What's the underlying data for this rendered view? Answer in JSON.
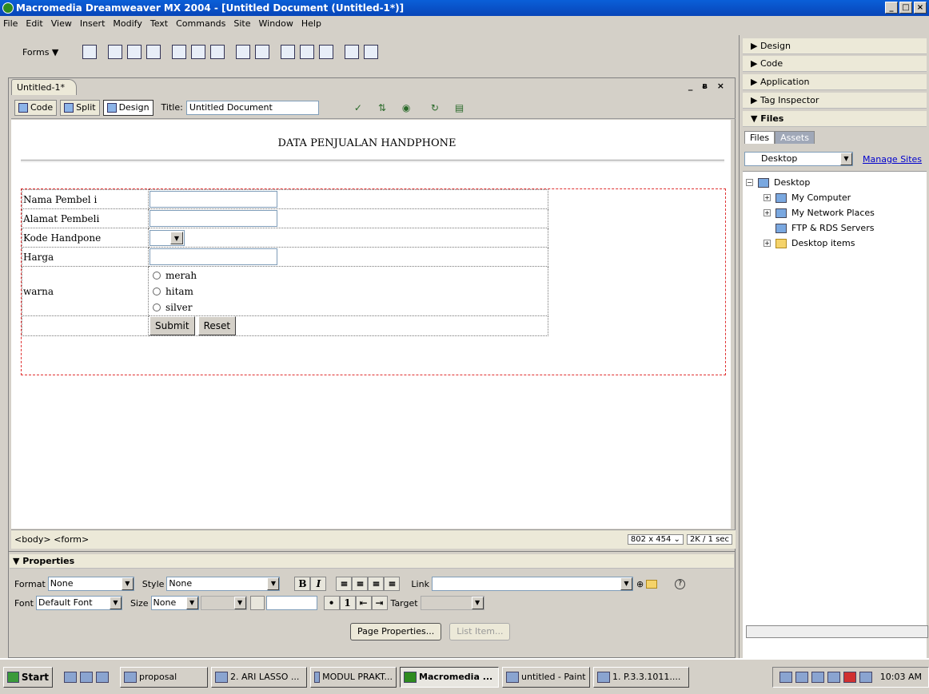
{
  "window": {
    "title": "Macromedia Dreamweaver MX 2004 - [Untitled Document (Untitled-1*)]",
    "controls": [
      "_",
      "□",
      "×"
    ]
  },
  "menubar": [
    "File",
    "Edit",
    "View",
    "Insert",
    "Modify",
    "Text",
    "Commands",
    "Site",
    "Window",
    "Help"
  ],
  "insert_bar": {
    "category": "Forms ▼"
  },
  "document": {
    "tab": "Untitled-1*",
    "window_controls": "_ ᴃ ×",
    "view_buttons": {
      "code": "Code",
      "split": "Split",
      "design": "Design"
    },
    "title_label": "Title:",
    "title_value": "Untitled Document"
  },
  "page": {
    "heading": "DATA PENJUALAN HANDPHONE",
    "form": {
      "rows": [
        {
          "label": "Nama Pembel i"
        },
        {
          "label": "Alamat Pembeli"
        },
        {
          "label": "Kode Handpone"
        },
        {
          "label": "Harga"
        },
        {
          "label": "warna"
        }
      ],
      "radios": [
        "merah",
        "hitam",
        "silver"
      ],
      "submit": "Submit",
      "reset": "Reset"
    }
  },
  "statusbar": {
    "tags": "<body> <form>",
    "size": "802 x 454 ⌄",
    "download": "2K / 1 sec"
  },
  "properties": {
    "header": "▼ Properties",
    "format_label": "Format",
    "format_value": "None",
    "style_label": "Style",
    "style_value": "None",
    "font_label": "Font",
    "font_value": "Default Font",
    "size_label": "Size",
    "size_value": "None",
    "link_label": "Link",
    "target_label": "Target",
    "bold": "B",
    "italic": "I",
    "page_properties": "Page Properties...",
    "list_item": "List Item..."
  },
  "right_panel": {
    "groups": [
      "▶ Design",
      "▶ Code",
      "▶ Application",
      "▶ Tag Inspector",
      "▼ Files"
    ],
    "tabs": [
      "Files",
      "Assets"
    ],
    "site_select": "Desktop",
    "manage_sites": "Manage Sites",
    "tree": [
      {
        "label": "Desktop",
        "level": 0,
        "toggle": "−"
      },
      {
        "label": "My Computer",
        "level": 1,
        "toggle": "+"
      },
      {
        "label": "My Network Places",
        "level": 1,
        "toggle": "+"
      },
      {
        "label": "FTP & RDS Servers",
        "level": 1,
        "toggle": ""
      },
      {
        "label": "Desktop items",
        "level": 1,
        "toggle": "+"
      }
    ]
  },
  "taskbar": {
    "start": "Start",
    "items": [
      {
        "label": "proposal",
        "active": false
      },
      {
        "label": "2. ARI LASSO ...",
        "active": false
      },
      {
        "label": "MODUL PRAKT...",
        "active": false
      },
      {
        "label": "Macromedia ...",
        "active": true
      },
      {
        "label": "untitled - Paint",
        "active": false
      },
      {
        "label": "1. P.3.3.1011....",
        "active": false
      }
    ],
    "clock": "10:03 AM"
  }
}
